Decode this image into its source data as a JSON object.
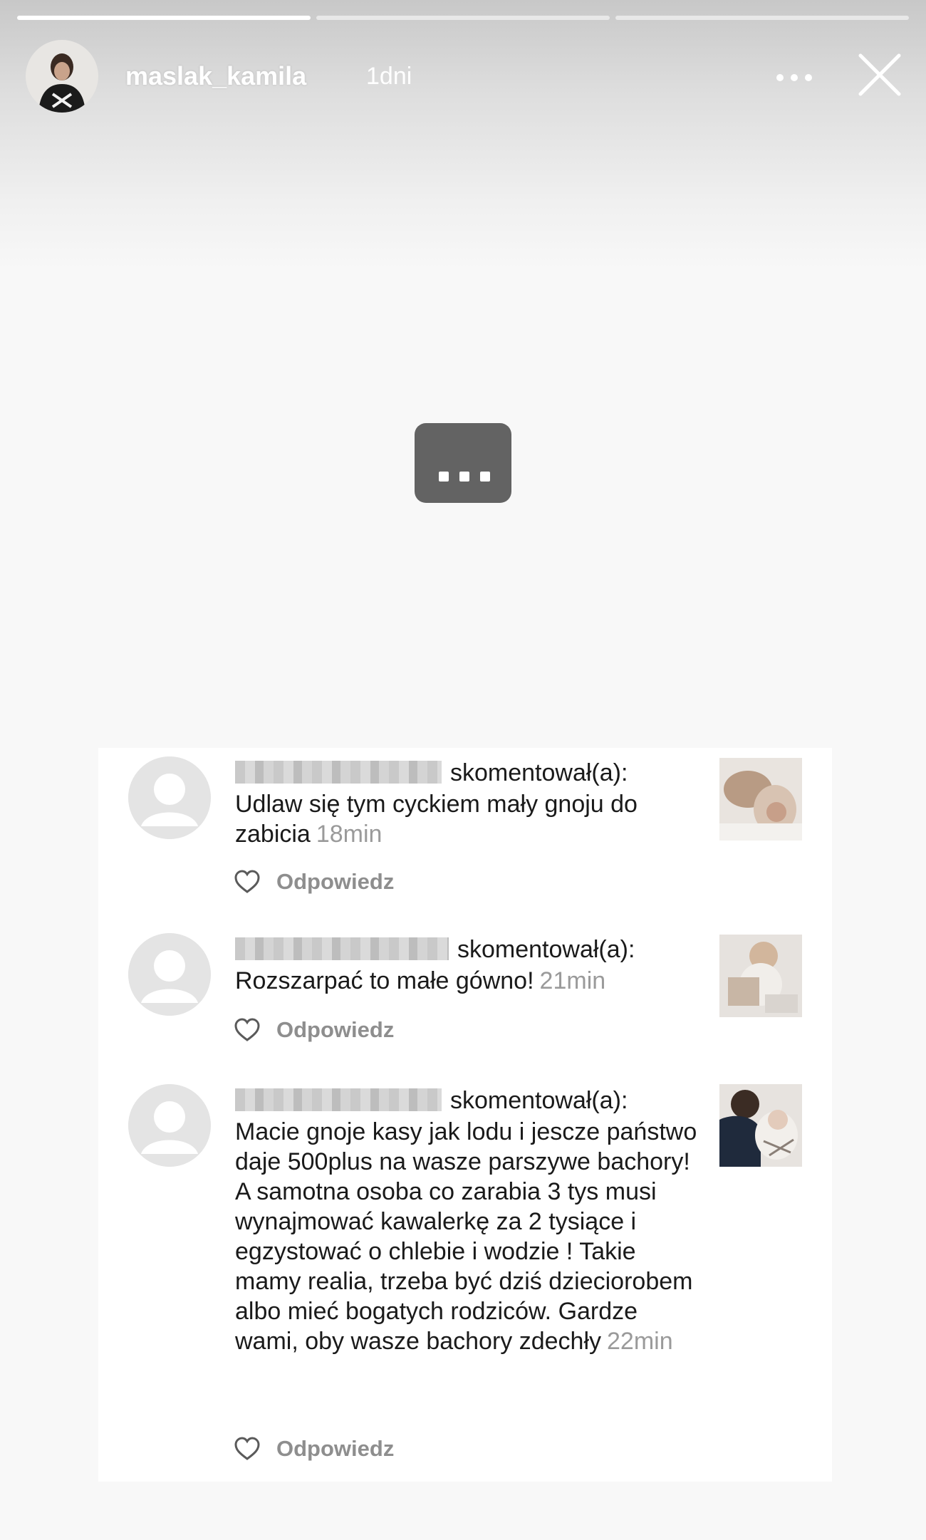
{
  "story": {
    "username": "maslak_kamila",
    "time_ago": "1dni",
    "progress": [
      1.0,
      0.0,
      0.0
    ],
    "center_label": "..."
  },
  "comments": [
    {
      "action": "skomentował(a):",
      "text": "Udlaw się tym cyckiem mały gnoju do zabicia",
      "time": "18min",
      "reply_label": "Odpowiedz"
    },
    {
      "action": "skomentował(a):",
      "text": "Rozszarpać to małe gówno!",
      "time": "21min",
      "reply_label": "Odpowiedz"
    },
    {
      "action": "skomentował(a):",
      "text": "Macie gnoje kasy jak lodu i jescze państwo daje 500plus na wasze parszywe bachory! A samotna osoba co zarabia 3 tys musi wynajmować kawalerkę za 2 tysiące i egzystować o chlebie i wodzie ! Takie mamy realia, trzeba być dziś dzieciorobem albo mieć bogatych rodziców. Gardze wami, oby wasze bachory zdechły",
      "time": "22min",
      "reply_label": "Odpowiedz"
    }
  ]
}
